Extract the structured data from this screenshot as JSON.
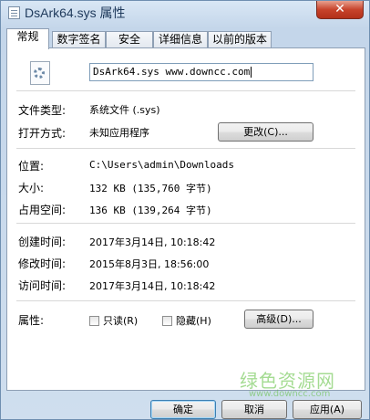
{
  "window": {
    "title": "DsArk64.sys 属性",
    "close_glyph": "✕"
  },
  "tabs": [
    {
      "label": "常规",
      "active": true
    },
    {
      "label": "数字签名",
      "active": false
    },
    {
      "label": "安全",
      "active": false
    },
    {
      "label": "详细信息",
      "active": false
    },
    {
      "label": "以前的版本",
      "active": false
    }
  ],
  "general": {
    "icon": "system-file-gear-icon",
    "file_name": "DsArk64.sys www.downcc.com",
    "file_type_label": "文件类型:",
    "file_type_value": "系统文件 (.sys)",
    "opens_with_label": "打开方式:",
    "opens_with_value": "未知应用程序",
    "change_button": "更改(C)...",
    "location_label": "位置:",
    "location_value": "C:\\Users\\admin\\Downloads",
    "size_label": "大小:",
    "size_value": "132 KB (135,760 字节)",
    "size_on_disk_label": "占用空间:",
    "size_on_disk_value": "136 KB (139,264 字节)",
    "created_label": "创建时间:",
    "created_value": "2017年3月14日, 10:18:42",
    "modified_label": "修改时间:",
    "modified_value": "2015年8月3日, 18:56:00",
    "accessed_label": "访问时间:",
    "accessed_value": "2017年3月14日, 10:18:42",
    "attributes_label": "属性:",
    "readonly_label": "只读(R)",
    "readonly_checked": false,
    "hidden_label": "隐藏(H)",
    "hidden_checked": false,
    "advanced_button": "高级(D)..."
  },
  "footer": {
    "ok_button": "确定",
    "cancel_button": "取消",
    "apply_button": "应用(A)"
  },
  "watermark": {
    "text": "绿色资源网",
    "url": "www.downcc.com"
  }
}
